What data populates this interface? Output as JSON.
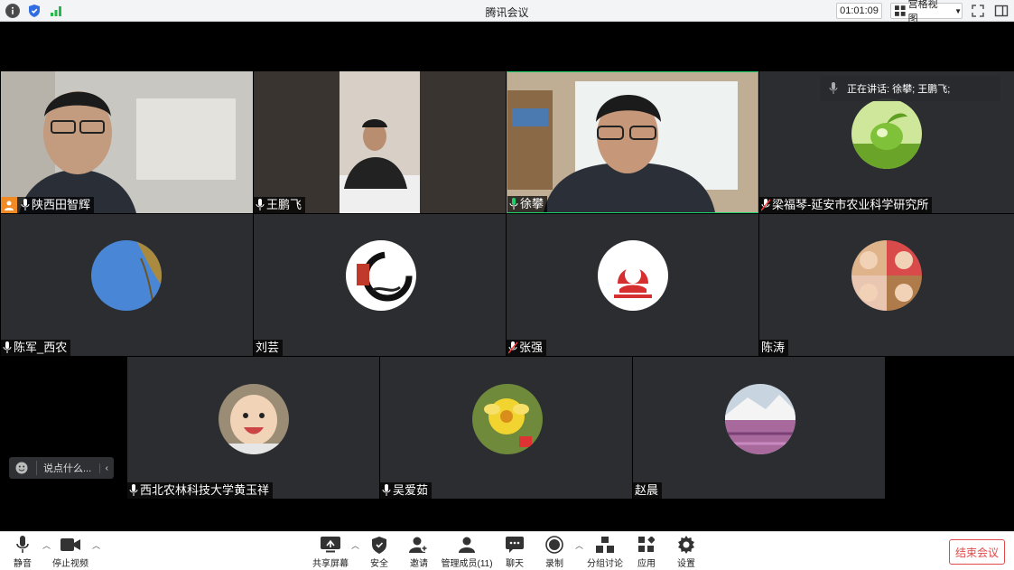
{
  "window": {
    "title": "腾讯会议",
    "timer": "01:01:09",
    "view_label": "宫格视图"
  },
  "speaking_indicator": "正在讲话: 徐攀; 王鹏飞;",
  "chat_placeholder": "说点什么...",
  "participants": [
    {
      "name": "陕西田智辉",
      "mic": "on",
      "host": true
    },
    {
      "name": "王鹏飞",
      "mic": "on"
    },
    {
      "name": "徐攀",
      "mic": "speaking"
    },
    {
      "name": "梁福琴-延安市农业科学研究所",
      "mic": "muted"
    },
    {
      "name": "陈军_西农",
      "mic": "on"
    },
    {
      "name": "刘芸",
      "mic": "none"
    },
    {
      "name": "张强",
      "mic": "muted"
    },
    {
      "name": "陈涛",
      "mic": "none"
    },
    {
      "name": "西北农林科技大学黄玉祥",
      "mic": "on"
    },
    {
      "name": "吴爱茹",
      "mic": "on"
    },
    {
      "name": "赵晨",
      "mic": "none"
    }
  ],
  "toolbar": {
    "mute": "静音",
    "stop_video": "停止视频",
    "share_screen": "共享屏幕",
    "security": "安全",
    "invite": "邀请",
    "manage_members": "管理成员(11)",
    "chat": "聊天",
    "record": "录制",
    "breakout": "分组讨论",
    "apps": "应用",
    "settings": "设置",
    "end_meeting": "结束会议"
  },
  "colors": {
    "accent": "#1ecf6b",
    "end": "#e04a4a",
    "host_badge": "#f08a24",
    "tile_bg": "#2b2d31"
  }
}
